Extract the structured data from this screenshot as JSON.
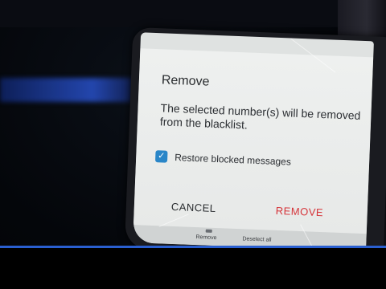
{
  "dialog": {
    "title": "Remove",
    "message": "The selected number(s) will be removed from the blacklist.",
    "checkbox_label": "Restore blocked messages",
    "checkbox_checked": true,
    "cancel_label": "CANCEL",
    "confirm_label": "REMOVE"
  },
  "toolbar": {
    "remove_label": "Remove",
    "deselect_label": "Deselect all"
  },
  "colors": {
    "confirm": "#d6353a",
    "checkbox": "#2a86c8",
    "stripe": "#2a5fd0"
  }
}
